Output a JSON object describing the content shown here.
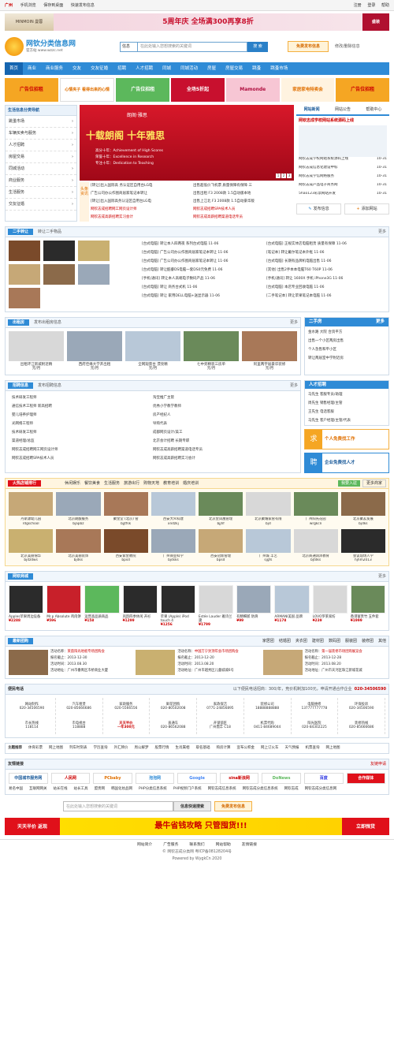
{
  "top": {
    "city": "广州",
    "mobile": "手机浏览",
    "save": "保存到桌面",
    "quick": "快速发布信息",
    "login": "注册",
    "reg": "登录",
    "help": "帮助"
  },
  "banner1": {
    "brand": "MINMOIN 曼蓉",
    "text": "5周年庆 全场满300再享8折",
    "tag": "盛装"
  },
  "logo": {
    "name": "网钦分类信息网",
    "sub": "官方站 www.wzzc.net"
  },
  "search": {
    "select": "信息",
    "placeholder": "在此处输入您想搜索的关键词",
    "button": "搜 索",
    "publish": "免费发布信息",
    "edit": "修改/删除信息"
  },
  "nav": [
    "首页",
    "商业",
    "商业服务",
    "交友",
    "交友征婚",
    "招聘",
    "人才招聘",
    "同城",
    "同城活动",
    "房屋",
    "房屋交易",
    "跳蚤",
    "跳蚤市场"
  ],
  "ads": [
    "广告位招租",
    "心情夹子 看得出来的心情",
    "广告位招租",
    "全场5折起",
    "Mamonde",
    "家居家电特卖会",
    "广告位招租"
  ],
  "leftnav": {
    "title": "生活信息分类导航",
    "items": [
      "跳蚤市场",
      "车辆买卖与服务",
      "人才招聘",
      "房屋交易",
      "同城活动",
      "商业服务",
      "生活服务",
      "交友征婚"
    ]
  },
  "slide": {
    "school": "朗阁·雅思",
    "title": "十载朗阁 十年雅思",
    "p1": "高分十年：Achievement of High Scores",
    "p2": "荣誉十年：Excellence in Research",
    "p3": "专注十年：Dedication to Teaching",
    "nums": [
      "1",
      "2",
      "3"
    ]
  },
  "news": {
    "tag": "头条资讯",
    "col1": [
      "[转让]出入国际高 务认证区自用台LG电",
      "广告公司办公作图商居家笔记本转让",
      "[转让]出入国际高务认证区自用台LG电",
      "网钦志成招聘网工网页设计师",
      "网钦志成高薪招聘实习会计"
    ],
    "col2": [
      "出售超低价飞机票 质量保障有保障 三",
      "出售出租 F3 2008款 1.5自动版本地",
      "出售上江北 F3 2008款 1.5自动豪华版",
      "网钦志成招聘SPA技术人员",
      "网钦志成高薪招聘渠道电话专员"
    ]
  },
  "right1": {
    "tabs": [
      "网站新闻",
      "网站公告",
      "帮助中心"
    ],
    "headline": "网钦志成学校网站系统源码上线",
    "items": [
      [
        "网钦志成学校网站系统源码上线",
        "10-31"
      ],
      [
        "网钦志成信息化建设中标",
        "10-31"
      ],
      [
        "网钦志成学信网络服务",
        "10-31"
      ],
      [
        "网钦志成产品电子商务网",
        "10-31"
      ],
      [
        "5hao123彩票网站开发",
        "10-31"
      ]
    ],
    "btn1": "发布信息",
    "btn2": "添加网站"
  },
  "ershou": {
    "title": "二手转让",
    "sub": "转让二手物品",
    "more": "更多",
    "list1": [
      [
        "[台式电脑] 转让本人四两夜 系列台式电脑",
        "11-06"
      ],
      [
        "[台式电脑] 广告公司办公作图商居家笔记本转让",
        "11-06"
      ],
      [
        "[台式电脑] 广告公司办公作图商居家笔记本转让",
        "11-06"
      ],
      [
        "[台式电脑] 转让酷睿DS电脑一套DS0元免费",
        "11-06"
      ],
      [
        "[手机/通讯] 转让本人高端电子数码产品",
        "11-06"
      ],
      [
        "[台式电脑] 转让 商务台式机",
        "11-06"
      ],
      [
        "[台式电脑] 转让 家用DELL电脑+送显示器",
        "11-06"
      ]
    ],
    "list2": [
      [
        "[台式电脑] 正规实体店电脑租赁 质量有保障",
        "11-06"
      ],
      [
        "[笔记本] 转让戴尔笔记本外框",
        "11-06"
      ],
      [
        "[台式电脑] 长期有品牌机电脑出售",
        "11-06"
      ],
      [
        "[其他] 出售2手本本电脑T60 T60P",
        "11-06"
      ],
      [
        "[手机/通讯] 转让 1600X 手机 iPhone3G",
        "11-06"
      ],
      [
        "[台式电脑] 本店专业回收电脑",
        "11-06"
      ],
      [
        "[二手笔记本] 转让苹果笔记本电脑",
        "11-06"
      ]
    ]
  },
  "chuzu": {
    "title": "出租房",
    "sub": "发布出租房信息",
    "more": "更多",
    "items": [
      [
        "出租环江新城附近精",
        "元/月"
      ],
      [
        "西府佳缘大学开出租",
        "元/月"
      ],
      [
        "全网观景台 漂亮精",
        "元/月"
      ],
      [
        "七中旁精装三房单",
        "元/月"
      ],
      [
        "阿里两字居豪华装修",
        "元/月"
      ]
    ]
  },
  "ershoufang": {
    "title": "二手房",
    "more": "更多",
    "items": [
      "金水路 大院 合资平方",
      "出售一个小区两房出售",
      "个人急售和平小区",
      "转让两居室中学附近房"
    ]
  },
  "zhaopin": {
    "title": "招聘信息",
    "sub": "发布招聘信息",
    "more": "更多",
    "col1": [
      "技术研发工程师",
      "通信技术工程师 新高招聘",
      "婴儿培养护理师",
      "光网络工程师",
      "技术研发工程师",
      "渠道经理/总监",
      "网钦志成招聘网工网页设计师",
      "网钦志成招聘SPA技术人员"
    ],
    "col2": [
      "淘宝推广主管",
      "优秀小学教学教师",
      "房产经纪人",
      "导购代表",
      "成都网页设计/美工",
      "北京会计招聘 长期专职",
      "网钦志成高薪招聘渠道电话专员",
      "网钦志成高薪招聘实习会计"
    ]
  },
  "rencai": {
    "title": "人才招聘",
    "items": [
      [
        "马先生",
        "客服专员/助理"
      ],
      [
        "周先生",
        "销售经理/主管"
      ],
      [
        "王先生",
        "电话客服"
      ],
      [
        "马先生",
        "客户经理/主管/代表"
      ]
    ],
    "btn1": "个人免费找工作",
    "btn2": "企业免费找人才"
  },
  "shops": {
    "title": "火热店铺排行",
    "tabs": [
      "休闲娱乐",
      "餐饮美食",
      "生活服务",
      "旅游出行",
      "购物天地",
      "教育培训",
      "婚庆培训"
    ],
    "btn1": "我要入驻",
    "btn2": "更多商家",
    "items": [
      [
        "丹斯源幼儿园",
        "rdgschool"
      ],
      [
        "北京朗酿服务",
        "bjapbz"
      ],
      [
        "聚金堂 (北京) 管",
        "bjjtfsk"
      ],
      [
        "西安大众科建",
        "xndzkj"
      ],
      [
        "北京金凤凰管理",
        "bjjhf"
      ],
      [
        "北京聚耀家管有限",
        "bjd"
      ],
      [
        "广州阳光花园",
        "wrgkcn"
      ],
      [
        "北京聚友发展",
        "bjdks"
      ],
      [
        "北京美丽锦华",
        "bjdzdws"
      ],
      [
        "北京美丽装饰",
        "bjdks"
      ],
      [
        "西安紫金教院",
        "bpsd"
      ],
      [
        "广州商业科学",
        "bjdsks"
      ],
      [
        "西安冠新管理",
        "bpsd"
      ],
      [
        "广州城 丰艺",
        "sjgfs"
      ],
      [
        "北京商通润泽教育",
        "bjtdks"
      ],
      [
        "会议现场入学",
        "hjhm2013"
      ],
      [
        "郑州星光",
        "love99"
      ],
      [
        "华通习海网",
        "adesvcv"
      ],
      [
        "苏氏牛肉",
        "ssfhbr"
      ],
      [
        "西安世家学院",
        "xasin"
      ],
      [
        "西安世博 机构",
        "xaklschool"
      ]
    ]
  },
  "goods": {
    "title": "网钦商城",
    "more": "更多",
    "items": [
      [
        "Apples苹果周边设备",
        "2288"
      ],
      [
        "Mr.p Absolute 鸡肉饼",
        "596"
      ],
      [
        "运营高品质商品",
        "158"
      ],
      [
        "风韵四季休闲 开衫",
        "1299"
      ],
      [
        "苹果 (Apple) iPod touch 4",
        "1256"
      ],
      [
        "Estée Lauder 雅诗兰黛",
        "1799"
      ],
      [
        "有精细腻 防滑",
        "99"
      ],
      [
        "ARMANI美国 品牌",
        "1178"
      ],
      [
        "LOVO罗莱家纺",
        "239"
      ],
      [
        "香港富贵竹 五件套",
        "1999"
      ]
    ]
  },
  "tuan": {
    "title": "最新团购",
    "tabs": [
      "家居团",
      "结婚团",
      "夹衣团",
      "建材团",
      "数码团",
      "服装团",
      "装修团",
      "其他"
    ],
    "items": [
      {
        "name": "莱茵阳光地板专场团购会",
        "start": "2013-12-30",
        "end": "2013.08.30",
        "addr": "广州市番禺区市桥商业大厦"
      },
      {
        "name": "中国万宁封顶年会市场团购会",
        "start": "2013-12-20",
        "end": "2013.08.20",
        "addr": "广州市越秀区儿童城城6号"
      },
      {
        "name": "第一届装修市场团购展览会",
        "start": "2013-12-28",
        "end": "2013.08.20",
        "addr": "广州市天河区珠江新城花城"
      }
    ]
  },
  "phones": {
    "title": "便民电话",
    "note": "以下便民电话招商：300/年，竞价机制加100元，申请开通合作企业",
    "phone": "020-34506590",
    "items": [
      [
        "网站制作",
        "020-34506590"
      ],
      [
        "汽车租赁",
        "020-85666686"
      ],
      [
        "家政服务",
        "020-5566556"
      ],
      [
        "鲜花团购",
        "020-80502008"
      ],
      [
        "家政保洁",
        "0771-24856895"
      ],
      [
        "装修公司",
        "18888888888"
      ],
      [
        "电脑维修",
        "137777777778"
      ],
      [
        "环保投诉",
        "020-34506590"
      ],
      [
        "市长热线",
        "118114"
      ],
      [
        "市电视台",
        "118888"
      ],
      [
        "天天半价",
        "一年300元"
      ],
      [
        "直通车",
        "020-86562088"
      ],
      [
        "开锁锁匠",
        "广州鼎丰 C18"
      ],
      [
        "机票代购",
        "0411-84689044"
      ],
      [
        "阳光医院",
        "020-84302225"
      ],
      [
        "装修热线",
        "020-85666686"
      ]
    ]
  },
  "hot": {
    "title": "主题推荐",
    "items": [
      "体育彩票",
      "网上地图",
      "列车时刻表",
      "学历查询",
      "外汇牌价",
      "周公解梦",
      "股票行情",
      "生肖属相",
      "取名基础",
      "购房计算",
      "宣布公积金",
      "网上订火车",
      "天气预报",
      "机票查询",
      "网上地图"
    ]
  },
  "links": {
    "title": "友情链接",
    "more": "友链申请",
    "logos": [
      "中国城市服务网",
      "人民网",
      "PCbaby",
      "泡泡网",
      "Google",
      "sina新浪网",
      "DoNews",
      "百度",
      "合作媒体"
    ],
    "text": [
      "易名中国",
      "互联网网关",
      "站长在线",
      "站长工具",
      "盟贵网",
      "韩国化妆品网",
      "PHP分类信息系统",
      "PHP视频门户系统",
      "网钦志成信息系统",
      "网钦志成分类信息系统",
      "网钦志成",
      "网钦志成分类信息网"
    ]
  },
  "footsearch": {
    "placeholder": "在此处输入您想搜索的关键词",
    "button": "信息快速搜索",
    "publish": "免费发布信息"
  },
  "fbanner": {
    "a": "天天半价 返现",
    "b": "最牛省钱攻略 只管囤货!!!",
    "c": "立即囤货"
  },
  "footer": {
    "links": [
      "网站简介",
      "广告服务",
      "联系我们",
      "网站帮助",
      "友情链接"
    ],
    "copy": "© 网钦志成分类网 粤ICP备08128204号",
    "power": "Powered by WygkCn 2020"
  }
}
